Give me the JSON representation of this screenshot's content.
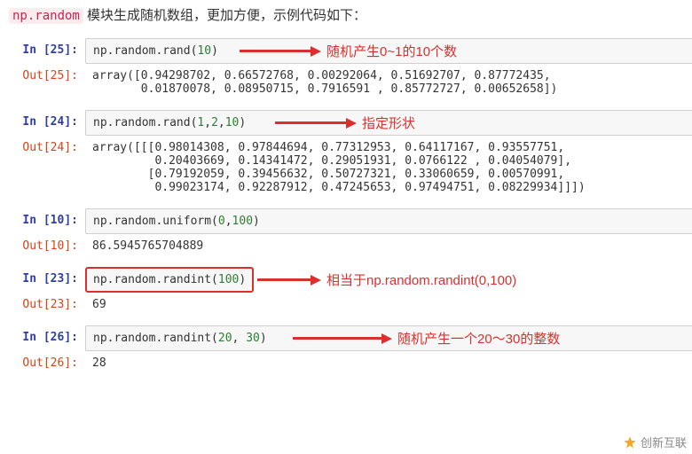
{
  "intro": {
    "code_tag": "np.random",
    "text": " 模块生成随机数组，更加方便，示例代码如下："
  },
  "cells": [
    {
      "in_prompt": "In [25]:",
      "code_html": "np.random.rand(<span class='nf'>10</span>)",
      "out_prompt": "Out[25]:",
      "output": "array([0.94298702, 0.66572768, 0.00292064, 0.51692707, 0.87772435,\n       0.01870078, 0.08950715, 0.7916591 , 0.85772727, 0.00652658])",
      "annotation": "随机产生0~1的10个数"
    },
    {
      "in_prompt": "In [24]:",
      "code_html": "np.random.rand(<span class='nf'>1</span>,<span class='nf'>2</span>,<span class='nf'>10</span>)",
      "out_prompt": "Out[24]:",
      "output": "array([[[0.98014308, 0.97844694, 0.77312953, 0.64117167, 0.93557751,\n         0.20403669, 0.14341472, 0.29051931, 0.0766122 , 0.04054079],\n        [0.79192059, 0.39456632, 0.50727321, 0.33060659, 0.00570991,\n         0.99023174, 0.92287912, 0.47245653, 0.97494751, 0.08229934]]])",
      "annotation": "指定形状"
    },
    {
      "in_prompt": "In [10]:",
      "code_html": "np.random.uniform(<span class='nf'>0</span>,<span class='nf'>100</span>)",
      "out_prompt": "Out[10]:",
      "output": "86.5945765704889",
      "annotation": null
    },
    {
      "in_prompt": "In [23]:",
      "code_html": "np.random.randint(<span class='nf'>100</span>)",
      "out_prompt": "Out[23]:",
      "output": "69",
      "annotation": "相当于np.random.randint(0,100)",
      "boxed": true
    },
    {
      "in_prompt": "In [26]:",
      "code_html": "np.random.randint(<span class='nf'>20</span>, <span class='nf'>30</span>)",
      "out_prompt": "Out[26]:",
      "output": "28",
      "annotation": "随机产生一个20～30的整数"
    }
  ],
  "watermark": "创新互联"
}
